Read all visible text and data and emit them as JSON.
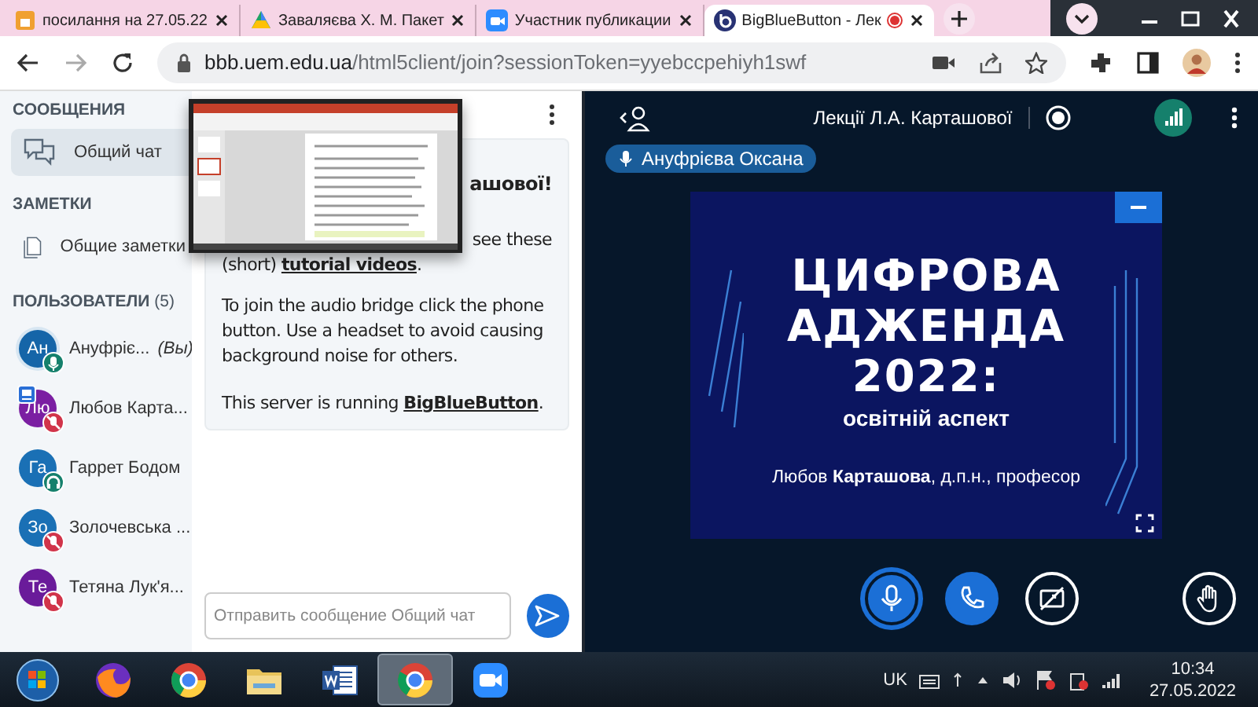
{
  "browser": {
    "tabs": [
      {
        "title": "посилання на 27.05.22",
        "kind": "sheet",
        "selected": false
      },
      {
        "title": "Заваляєва Х. М. Пакет",
        "kind": "drive",
        "selected": false
      },
      {
        "title": "Участник публикации",
        "kind": "camera",
        "selected": false
      },
      {
        "title": "BigBlueButton - Лек",
        "kind": "bbb",
        "selected": true
      }
    ],
    "url_host": "bbb.uem.edu.ua",
    "url_path": "/html5client/join?sessionToken=yyebccpehiyh1swf"
  },
  "sidebar": {
    "messages_heading": "СООБЩЕНИЯ",
    "chat_item": {
      "label": "Общий чат",
      "selected": true
    },
    "notes_heading": "ЗАМЕТКИ",
    "notes_item": {
      "label": "Общие заметки",
      "selected": false
    },
    "users_heading": "ПОЛЬЗОВАТЕЛИ",
    "users_count": "(5)",
    "users": [
      {
        "initials": "Ан",
        "name": "Ануфріє...",
        "suffix": "(Вы)",
        "color": "#1565a8",
        "muted": false,
        "listen_only": false,
        "presenter": false,
        "me": true
      },
      {
        "initials": "Лю",
        "name": "Любов Карта...",
        "color": "#7b1fa2",
        "muted": true,
        "listen_only": false,
        "presenter": true,
        "me": false
      },
      {
        "initials": "Га",
        "name": "Гаррет Бодом",
        "color": "#1a70b5",
        "muted": false,
        "listen_only": true,
        "presenter": false,
        "me": false
      },
      {
        "initials": "Зо",
        "name": "Золочевська ...",
        "color": "#1a70b5",
        "muted": true,
        "listen_only": false,
        "presenter": false,
        "me": false
      },
      {
        "initials": "Те",
        "name": "Тетяна Лук'я...",
        "color": "#6a1b9a",
        "muted": true,
        "listen_only": false,
        "presenter": false,
        "me": false
      }
    ]
  },
  "chat": {
    "welcome": [
      {
        "kind": "heading-tail",
        "parts": [
          {
            "text": "ашової!"
          }
        ]
      },
      {
        "kind": "tail",
        "parts": [
          {
            "text": "see these"
          }
        ]
      },
      {
        "kind": "line",
        "parts": [
          {
            "text": "(short) "
          },
          {
            "text": "tutorial videos",
            "link": true
          },
          {
            "text": "."
          }
        ]
      },
      {
        "kind": "para",
        "parts": [
          {
            "text": "To join the audio bridge click the phone button. Use a headset to avoid causing background noise for others."
          }
        ]
      },
      {
        "kind": "para",
        "parts": [
          {
            "text": "This server is running "
          },
          {
            "text": "BigBlueButton",
            "link": true
          },
          {
            "text": "."
          }
        ]
      }
    ],
    "placeholder": "Отправить сообщение Общий чат"
  },
  "meeting": {
    "title": "Лекції Л.А. Карташової",
    "recording": true,
    "talker": "Ануфрієва Оксана",
    "slide": {
      "title_lines": [
        "ЦИФРОВА",
        "АДЖЕНДА",
        "2022:"
      ],
      "subtitle": "освітній аспект",
      "author": "Любов **Карташова**, д.п.н., професор"
    },
    "controls": [
      {
        "kind": "mic",
        "on": true
      },
      {
        "kind": "phone",
        "on": true
      },
      {
        "kind": "screen",
        "on": false
      },
      {
        "kind": "hand",
        "on": false
      }
    ]
  },
  "taskbar": {
    "apps": [
      {
        "kind": "start",
        "selected": false
      },
      {
        "kind": "fox",
        "selected": false
      },
      {
        "kind": "globe",
        "selected": false
      },
      {
        "kind": "folder",
        "selected": false
      },
      {
        "kind": "document",
        "selected": false
      },
      {
        "kind": "globe",
        "selected": true
      },
      {
        "kind": "camera",
        "selected": false
      }
    ],
    "language": "UK",
    "time": "10:34",
    "date": "27.05.2022"
  }
}
